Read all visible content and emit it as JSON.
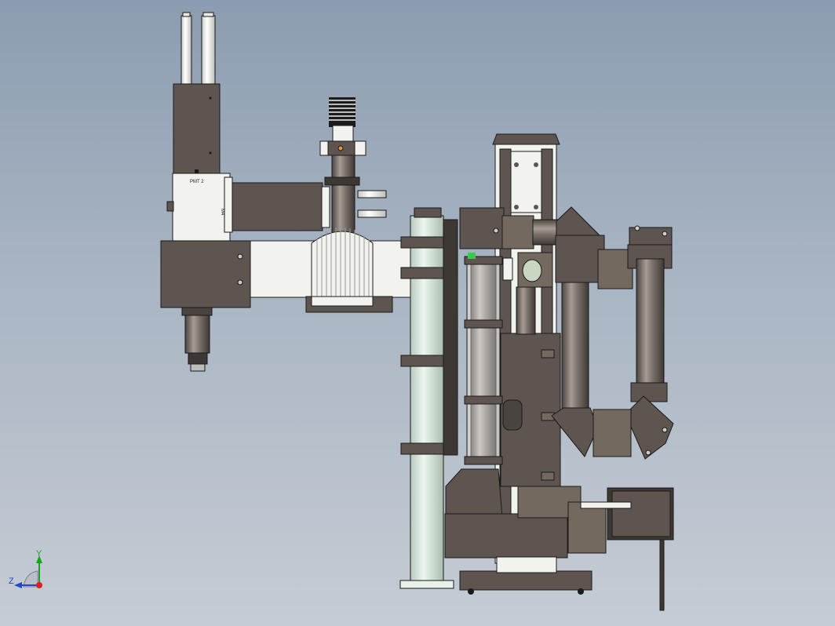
{
  "viewport": {
    "background_top": "#8c9cb0",
    "background_bottom": "#c5ccd4",
    "colors": {
      "body_brown": "#5e5550",
      "body_brown_light": "#74695f",
      "white_part": "#f2f2ee",
      "pale_green": "#d8e8dc",
      "outline": "#1a1a1a",
      "accent_green": "#3cc84a"
    }
  },
  "labels": {
    "pmt_label": "PMT 2",
    "side_label": "M4",
    "side_label_2": "PMT"
  },
  "triad": {
    "y_label": "Y",
    "z_label": "Z",
    "y_color": "#1aa31a",
    "z_color": "#2448c8",
    "origin_color": "#e02020"
  }
}
